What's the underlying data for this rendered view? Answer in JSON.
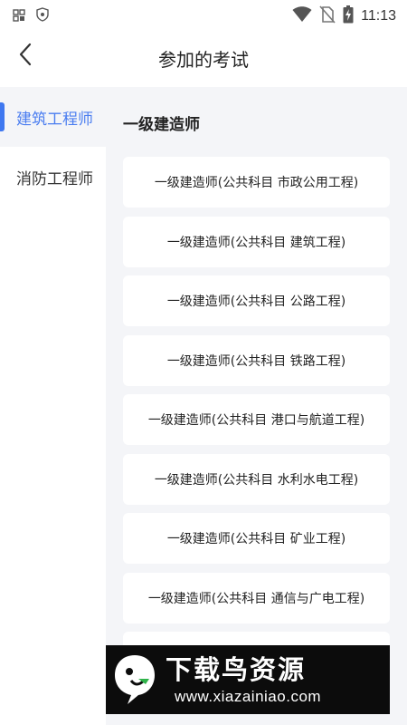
{
  "status_bar": {
    "time": "11:13",
    "left_icons": [
      "grid-icon",
      "shield-icon"
    ],
    "right_icons": [
      "wifi-icon",
      "no-sim-icon",
      "battery-charging-icon"
    ]
  },
  "header": {
    "title": "参加的考试",
    "back_icon": "chevron-left-icon"
  },
  "sidebar": {
    "items": [
      {
        "label": "建筑工程师",
        "active": true
      },
      {
        "label": "消防工程师",
        "active": false
      }
    ]
  },
  "main": {
    "section_title": "一级建造师",
    "cards": [
      "一级建造师(公共科目 市政公用工程)",
      "一级建造师(公共科目 建筑工程)",
      "一级建造师(公共科目 公路工程)",
      "一级建造师(公共科目 铁路工程)",
      "一级建造师(公共科目 港口与航道工程)",
      "一级建造师(公共科目 水利水电工程)",
      "一级建造师(公共科目 矿业工程)",
      "一级建造师(公共科目 通信与广电工程)"
    ]
  },
  "watermark": {
    "name": "下载鸟资源",
    "url": "www.xiazainiao.com"
  },
  "colors": {
    "accent": "#3f78f0",
    "active_text": "#4a7df0",
    "content_background": "#f4f5f8",
    "card_background": "#ffffff"
  }
}
